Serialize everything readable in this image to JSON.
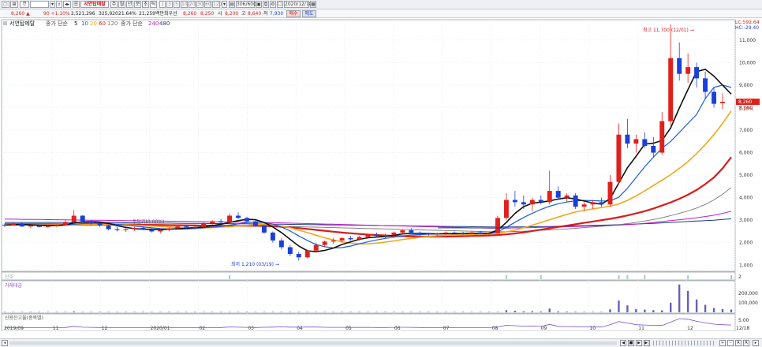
{
  "toolbar": {
    "stock_code": "",
    "stock_name": "서연탑메탈",
    "chart_types": [
      "주",
      "월",
      "년",
      "분",
      "초",
      "틱"
    ],
    "periods": [
      "1",
      "3",
      "5",
      "10",
      "20",
      "30",
      "60",
      "120"
    ],
    "count": "306/600",
    "date": "2020/12/18"
  },
  "quote": {
    "price": "8,260 ▲",
    "change": "90 +1.10%",
    "volume": "2,521,296",
    "turnover": "325,920",
    "turnover_pct": "21.64%",
    "amount": "21,259백만",
    "rank": "최우선",
    "bid": "8,260",
    "ask": "8,250",
    "open_label": "시",
    "open": "8,200",
    "high_label": "고",
    "high": "8,640",
    "low_label": "저",
    "low": "7,930",
    "buy_label": "매수",
    "sell_label": "매도"
  },
  "legend": {
    "stock": "서연탑메탈",
    "ma_label": "종가 단순",
    "ma_periods": [
      "5",
      "10",
      "20",
      "60",
      "120"
    ],
    "ma_long_label": "종가 단순",
    "ma_long_periods": [
      "240",
      "480"
    ]
  },
  "price_chart": {
    "type": "candlestick",
    "y_ticks": [
      "11,000",
      "10,000",
      "9,000",
      "8,000",
      "7,000",
      "6,000",
      "5,000",
      "4,000",
      "3,000",
      "2,000",
      "1,000"
    ],
    "ylim": [
      800,
      11800
    ],
    "right_labels": {
      "lc": "LC:592.64",
      "hc": "HC:-29.40",
      "current": "8,260",
      "current_sub": "1.10%"
    },
    "annotations": {
      "high": "최고 11,700 (12/01) →",
      "low": "최저 1,210 (03/19) →",
      "mid": "투단가(0.00%)"
    },
    "x_labels": [
      "2019/09",
      "11",
      "12",
      "2020/01",
      "02",
      "03",
      "04",
      "05",
      "06",
      "07",
      "08",
      "09",
      "10",
      "11",
      "12",
      "12/18"
    ],
    "colors": {
      "up": "#e0201c",
      "down": "#1c3fd8",
      "ma5": "#111111",
      "ma10": "#1c5ed8",
      "ma20": "#f2a81d",
      "ma60": "#d81c1c",
      "ma120": "#777777",
      "ma240": "#c01cc8",
      "ma480": "#1c3a8a"
    },
    "ohlc": [
      [
        2800,
        2850,
        2700,
        2780
      ],
      [
        2780,
        2900,
        2750,
        2850
      ],
      [
        2850,
        2880,
        2700,
        2720
      ],
      [
        2720,
        2800,
        2650,
        2760
      ],
      [
        2760,
        2820,
        2680,
        2700
      ],
      [
        2700,
        2780,
        2650,
        2740
      ],
      [
        2740,
        2800,
        2700,
        2780
      ],
      [
        2780,
        3000,
        2760,
        2920
      ],
      [
        2920,
        3450,
        2850,
        3200
      ],
      [
        3200,
        3220,
        2900,
        2950
      ],
      [
        2950,
        3000,
        2800,
        2880
      ],
      [
        2880,
        2900,
        2700,
        2760
      ],
      [
        2760,
        2800,
        2550,
        2600
      ],
      [
        2600,
        2700,
        2500,
        2560
      ],
      [
        2560,
        2650,
        2480,
        2600
      ],
      [
        2600,
        2700,
        2520,
        2660
      ],
      [
        2660,
        2720,
        2550,
        2580
      ],
      [
        2580,
        2650,
        2450,
        2500
      ],
      [
        2500,
        2600,
        2420,
        2560
      ],
      [
        2560,
        2680,
        2500,
        2640
      ],
      [
        2640,
        2750,
        2600,
        2720
      ],
      [
        2720,
        2800,
        2620,
        2680
      ],
      [
        2680,
        2750,
        2600,
        2700
      ],
      [
        2700,
        2900,
        2680,
        2860
      ],
      [
        2860,
        3000,
        2800,
        2950
      ],
      [
        2950,
        3050,
        2850,
        2900
      ],
      [
        2900,
        3300,
        2880,
        3200
      ],
      [
        3200,
        3350,
        3050,
        3100
      ],
      [
        3100,
        3150,
        2900,
        2950
      ],
      [
        2950,
        3000,
        2700,
        2750
      ],
      [
        2750,
        2800,
        2400,
        2450
      ],
      [
        2450,
        2500,
        2000,
        2100
      ],
      [
        2100,
        2200,
        1700,
        1800
      ],
      [
        1800,
        1900,
        1400,
        1500
      ],
      [
        1500,
        1600,
        1210,
        1350
      ],
      [
        1350,
        1700,
        1300,
        1650
      ],
      [
        1650,
        2000,
        1600,
        1900
      ],
      [
        1900,
        2100,
        1800,
        2050
      ],
      [
        2050,
        2200,
        1950,
        2100
      ],
      [
        2100,
        2250,
        2000,
        2200
      ],
      [
        2200,
        2300,
        2100,
        2150
      ],
      [
        2150,
        2300,
        2100,
        2250
      ],
      [
        2250,
        2400,
        2200,
        2350
      ],
      [
        2350,
        2450,
        2250,
        2300
      ],
      [
        2300,
        2400,
        2200,
        2350
      ],
      [
        2350,
        2500,
        2300,
        2450
      ],
      [
        2450,
        2600,
        2400,
        2550
      ],
      [
        2550,
        2650,
        2400,
        2450
      ],
      [
        2450,
        2500,
        2300,
        2400
      ],
      [
        2400,
        2450,
        2300,
        2380
      ],
      [
        2380,
        2450,
        2300,
        2420
      ],
      [
        2420,
        2500,
        2350,
        2450
      ],
      [
        2450,
        2500,
        2380,
        2420
      ],
      [
        2420,
        2480,
        2350,
        2400
      ],
      [
        2400,
        2500,
        2380,
        2460
      ],
      [
        2460,
        2520,
        2380,
        2400
      ],
      [
        2400,
        2480,
        2350,
        2420
      ],
      [
        2420,
        3200,
        2400,
        3100
      ],
      [
        3100,
        4200,
        3000,
        3900
      ],
      [
        3900,
        4300,
        3600,
        3800
      ],
      [
        3800,
        4100,
        3500,
        3700
      ],
      [
        3700,
        4000,
        3400,
        3900
      ],
      [
        3900,
        4100,
        3700,
        3800
      ],
      [
        3800,
        5200,
        3700,
        4300
      ],
      [
        4300,
        4500,
        3900,
        4000
      ],
      [
        4000,
        4200,
        3800,
        4100
      ],
      [
        4100,
        4200,
        3500,
        3600
      ],
      [
        3600,
        3800,
        3400,
        3700
      ],
      [
        3700,
        3900,
        3500,
        3800
      ],
      [
        3800,
        4000,
        3600,
        3700
      ],
      [
        3700,
        5000,
        3600,
        4700
      ],
      [
        4700,
        7300,
        4600,
        6800
      ],
      [
        6800,
        7500,
        6200,
        6400
      ],
      [
        6400,
        6800,
        6000,
        6600
      ],
      [
        6600,
        6900,
        6200,
        6300
      ],
      [
        6300,
        6700,
        5800,
        6000
      ],
      [
        6000,
        7800,
        5900,
        7400
      ],
      [
        7400,
        11700,
        7200,
        10200
      ],
      [
        10200,
        10900,
        9200,
        9500
      ],
      [
        9500,
        10400,
        9100,
        9800
      ],
      [
        9800,
        10000,
        8900,
        9300
      ],
      [
        9300,
        9600,
        8400,
        8700
      ],
      [
        8700,
        8900,
        8000,
        8170
      ],
      [
        8200,
        8640,
        7930,
        8260
      ]
    ],
    "ma5": [
      2780,
      2800,
      2810,
      2790,
      2770,
      2760,
      2760,
      2790,
      2880,
      2920,
      2940,
      2920,
      2860,
      2760,
      2680,
      2620,
      2600,
      2590,
      2580,
      2600,
      2620,
      2640,
      2670,
      2700,
      2760,
      2820,
      2900,
      2980,
      3040,
      3020,
      2900,
      2700,
      2450,
      2150,
      1850,
      1640,
      1600,
      1660,
      1760,
      1920,
      2040,
      2150,
      2220,
      2250,
      2280,
      2330,
      2390,
      2410,
      2410,
      2400,
      2390,
      2400,
      2400,
      2410,
      2420,
      2420,
      2420,
      2560,
      2900,
      3300,
      3600,
      3760,
      3800,
      3860,
      3940,
      4000,
      3940,
      3850,
      3760,
      3710,
      3960,
      4650,
      5330,
      5840,
      6380,
      6420,
      6540,
      7100,
      7980,
      8800,
      9600,
      9700,
      9400,
      9000,
      8600
    ],
    "ma10": [
      2790,
      2795,
      2800,
      2800,
      2790,
      2780,
      2770,
      2780,
      2820,
      2850,
      2860,
      2860,
      2850,
      2820,
      2780,
      2740,
      2700,
      2660,
      2630,
      2610,
      2600,
      2610,
      2630,
      2660,
      2690,
      2720,
      2780,
      2840,
      2890,
      2920,
      2900,
      2830,
      2700,
      2520,
      2300,
      2100,
      1920,
      1820,
      1770,
      1780,
      1850,
      1950,
      2040,
      2120,
      2190,
      2250,
      2300,
      2340,
      2360,
      2380,
      2390,
      2400,
      2400,
      2400,
      2400,
      2410,
      2410,
      2480,
      2680,
      2910,
      3120,
      3310,
      3480,
      3620,
      3730,
      3810,
      3860,
      3880,
      3870,
      3850,
      3860,
      4020,
      4420,
      4900,
      5370,
      5800,
      6200,
      6500,
      6900,
      7300,
      7700,
      8400,
      8900,
      9000,
      8900
    ],
    "ma20": [
      2800,
      2800,
      2800,
      2800,
      2800,
      2795,
      2790,
      2790,
      2800,
      2810,
      2820,
      2830,
      2830,
      2820,
      2800,
      2780,
      2760,
      2740,
      2720,
      2700,
      2680,
      2670,
      2660,
      2660,
      2670,
      2690,
      2710,
      2740,
      2770,
      2800,
      2810,
      2790,
      2740,
      2660,
      2560,
      2450,
      2330,
      2220,
      2120,
      2040,
      1980,
      1950,
      1950,
      1980,
      2030,
      2080,
      2140,
      2190,
      2240,
      2280,
      2310,
      2330,
      2350,
      2360,
      2370,
      2380,
      2390,
      2420,
      2480,
      2560,
      2660,
      2780,
      2900,
      3020,
      3140,
      3260,
      3360,
      3440,
      3500,
      3560,
      3620,
      3720,
      3880,
      4080,
      4300,
      4540,
      4780,
      5020,
      5300,
      5600,
      5960,
      6360,
      6800,
      7300,
      7860
    ],
    "ma60": [
      2800,
      2800,
      2800,
      2800,
      2800,
      2800,
      2800,
      2800,
      2800,
      2800,
      2805,
      2810,
      2810,
      2810,
      2805,
      2800,
      2795,
      2790,
      2785,
      2780,
      2775,
      2770,
      2765,
      2760,
      2755,
      2750,
      2750,
      2750,
      2750,
      2750,
      2745,
      2730,
      2710,
      2680,
      2650,
      2610,
      2570,
      2530,
      2490,
      2450,
      2420,
      2390,
      2360,
      2340,
      2320,
      2300,
      2290,
      2280,
      2270,
      2270,
      2270,
      2270,
      2280,
      2290,
      2300,
      2310,
      2320,
      2340,
      2370,
      2410,
      2460,
      2520,
      2580,
      2640,
      2700,
      2760,
      2820,
      2880,
      2940,
      3000,
      3060,
      3130,
      3210,
      3300,
      3400,
      3520,
      3650,
      3790,
      3950,
      4130,
      4340,
      4600,
      4900,
      5300,
      5800
    ],
    "ma120": [
      2850,
      2850,
      2850,
      2850,
      2850,
      2850,
      2845,
      2840,
      2840,
      2840,
      2840,
      2840,
      2835,
      2830,
      2825,
      2820,
      2815,
      2810,
      2805,
      2800,
      2795,
      2790,
      2785,
      2780,
      2775,
      2770,
      2765,
      2760,
      2755,
      2750,
      2745,
      2740,
      2730,
      2720,
      2710,
      2700,
      2690,
      2680,
      2670,
      2660,
      2650,
      2640,
      2630,
      2620,
      2610,
      2600,
      2590,
      2580,
      2570,
      2560,
      2550,
      2540,
      2530,
      2520,
      2510,
      2500,
      2490,
      2490,
      2490,
      2500,
      2510,
      2530,
      2550,
      2570,
      2590,
      2610,
      2640,
      2670,
      2700,
      2730,
      2760,
      2800,
      2850,
      2900,
      2960,
      3030,
      3110,
      3200,
      3300,
      3410,
      3540,
      3700,
      3900,
      4150,
      4450
    ],
    "ma240": [
      3050,
      3045,
      3040,
      3035,
      3030,
      3025,
      3020,
      3015,
      3010,
      3005,
      3000,
      2995,
      2990,
      2985,
      2980,
      2975,
      2970,
      2965,
      2960,
      2955,
      2950,
      2945,
      2940,
      2935,
      2930,
      2925,
      2920,
      2915,
      2910,
      2905,
      2900,
      2890,
      2880,
      2870,
      2860,
      2850,
      2840,
      2830,
      2820,
      2810,
      2800,
      2790,
      2780,
      2770,
      2760,
      2750,
      2740,
      2730,
      2720,
      2710,
      2700,
      2690,
      2680,
      2670,
      2660,
      2655,
      2650,
      2650,
      2650,
      2655,
      2660,
      2670,
      2680,
      2690,
      2700,
      2710,
      2720,
      2730,
      2740,
      2750,
      2760,
      2780,
      2800,
      2830,
      2860,
      2900,
      2940,
      2980,
      3020,
      3060,
      3110,
      3160,
      3220,
      3300,
      3400
    ],
    "ma480": [
      2900,
      2900,
      2900,
      2900,
      2900,
      2900,
      2900,
      2900,
      2900,
      2900,
      2895,
      2890,
      2890,
      2890,
      2885,
      2880,
      2880,
      2875,
      2870,
      2870,
      2865,
      2860,
      2860,
      2855,
      2850,
      2850,
      2845,
      2840,
      2840,
      2835,
      2830,
      2825,
      2820,
      2815,
      2810,
      2805,
      2800,
      2795,
      2790,
      2785,
      2780,
      2775,
      2770,
      2765,
      2760,
      2755,
      2750,
      2745,
      2740,
      2735,
      2730,
      2725,
      2720,
      2715,
      2710,
      2705,
      2700,
      2700,
      2700,
      2700,
      2705,
      2710,
      2715,
      2720,
      2730,
      2740,
      2750,
      2760,
      2770,
      2780,
      2790,
      2800,
      2815,
      2830,
      2845,
      2860,
      2880,
      2900,
      2920,
      2940,
      2960,
      2980,
      3000,
      3030,
      3060
    ]
  },
  "panel2": {
    "title": "신호",
    "tick": "2",
    "bars": [
      0,
      0,
      0,
      0,
      0,
      0,
      0,
      0,
      0,
      0,
      0,
      0,
      0,
      0,
      0,
      0,
      0,
      0,
      0,
      0,
      0,
      0,
      0,
      0,
      0,
      0,
      1,
      0,
      0,
      0,
      0,
      0,
      0,
      0,
      0,
      0,
      0,
      0,
      0,
      0,
      0,
      0,
      0,
      0,
      0,
      0,
      0,
      0,
      0,
      0,
      0,
      0,
      0,
      0,
      0,
      0,
      0,
      0,
      1,
      0,
      0,
      0,
      1,
      0,
      0,
      0,
      0,
      0,
      0,
      0,
      0,
      1,
      1,
      0,
      1,
      0,
      0,
      0,
      0,
      1,
      0,
      0,
      0,
      0,
      1
    ]
  },
  "panel3": {
    "title": "거래대금",
    "ticks": [
      "200,000",
      "100,000"
    ],
    "ylim": [
      0,
      280000
    ],
    "bars": [
      500,
      600,
      500,
      400,
      500,
      600,
      500,
      900,
      8000,
      2000,
      1200,
      800,
      600,
      500,
      500,
      400,
      500,
      500,
      400,
      500,
      600,
      500,
      500,
      700,
      900,
      800,
      3000,
      1800,
      1200,
      900,
      1600,
      2500,
      3500,
      2500,
      1800,
      2800,
      2600,
      1500,
      1200,
      1400,
      1000,
      1100,
      1200,
      900,
      900,
      1200,
      1500,
      1200,
      900,
      700,
      600,
      700,
      600,
      500,
      600,
      500,
      600,
      3000,
      20000,
      14000,
      9000,
      10000,
      7000,
      35000,
      8000,
      6000,
      5000,
      4000,
      3000,
      2800,
      28000,
      110000,
      65000,
      30000,
      25000,
      20000,
      18000,
      90000,
      260000,
      200000,
      120000,
      70000,
      40000,
      30000,
      25000
    ]
  },
  "panel4": {
    "title": "신용잔고율(종목별)",
    "tick": "5.00"
  },
  "bottom": {
    "buttons": [
      "◀",
      "■",
      "▶",
      "▶|",
      "+",
      "-",
      "A",
      "A"
    ]
  }
}
